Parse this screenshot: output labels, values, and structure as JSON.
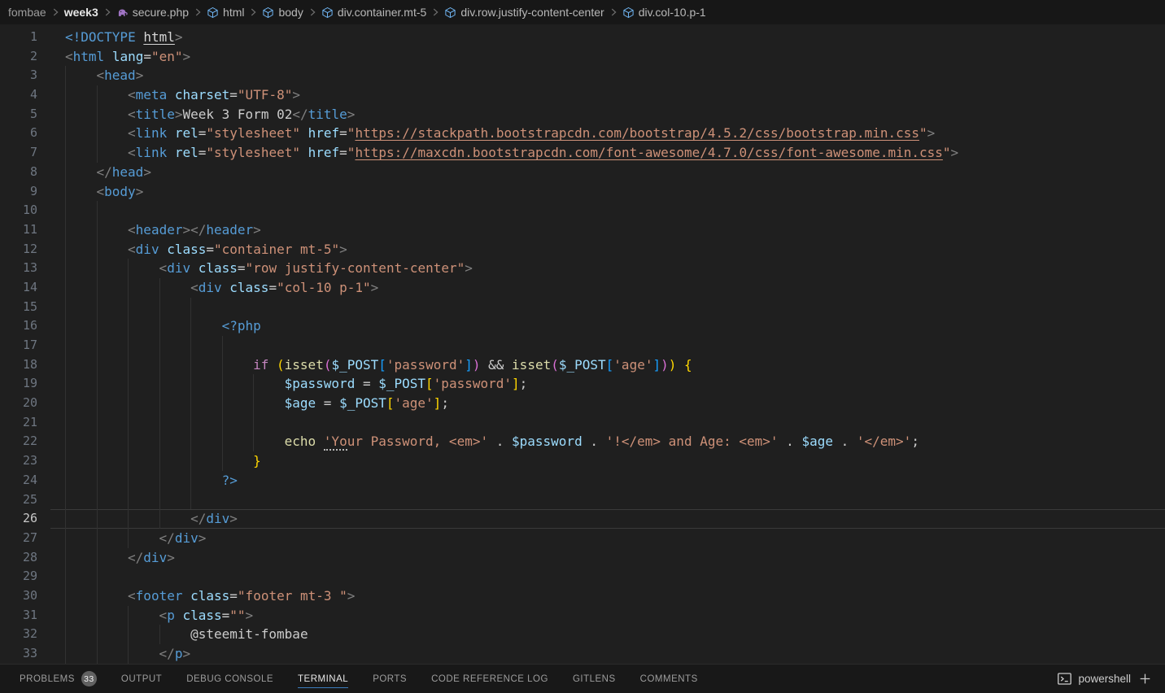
{
  "colors": {
    "bg": "#1f1f1f",
    "topbar_bg": "#171717",
    "panel_bg": "#181818",
    "border": "#2b2b2b",
    "accent": "#0078d4",
    "linenum": "#6e7681",
    "linenum_active": "#c8c8c8",
    "guide": "#313131",
    "cur_border": "#3a3a3a",
    "tag": "#569cd6",
    "punct": "#808080",
    "attr": "#9cdcfe",
    "string": "#ce9178",
    "keyword": "#c586c0",
    "func": "#dcdcaa",
    "plain": "#cccccc",
    "b1": "#ffd700",
    "b2": "#da70d6",
    "b3": "#179fff",
    "badge_bg": "#616161",
    "badge_fg": "#f2f2f2",
    "tab_fg": "#9d9d9d",
    "tab_active_fg": "#e7e7e7",
    "bc_fg": "#b8b8b8",
    "bc_dim": "#9d9d9d",
    "bc_bright": "#e7e7e7",
    "cube": "#75beff",
    "php": "#a074c4"
  },
  "breadcrumb": {
    "items": [
      {
        "label": "fombae",
        "icon": null,
        "style": "dim"
      },
      {
        "label": "week3",
        "icon": null,
        "style": "bright"
      },
      {
        "label": "secure.php",
        "icon": "php",
        "style": ""
      },
      {
        "label": "html",
        "icon": "cube",
        "style": ""
      },
      {
        "label": "body",
        "icon": "cube",
        "style": ""
      },
      {
        "label": "div.container.mt-5",
        "icon": "cube",
        "style": ""
      },
      {
        "label": "div.row.justify-content-center",
        "icon": "cube",
        "style": ""
      },
      {
        "label": "div.col-10.p-1",
        "icon": "cube",
        "style": ""
      }
    ]
  },
  "editor": {
    "current_line": 26,
    "lines": [
      {
        "n": 1,
        "ind": 0,
        "g": 0,
        "tokens": [
          [
            "t",
            "<!DOCTYPE"
          ],
          [
            "w",
            " "
          ],
          [
            "wu",
            "html"
          ],
          [
            "p",
            ">"
          ]
        ]
      },
      {
        "n": 2,
        "ind": 0,
        "g": 0,
        "tokens": [
          [
            "p",
            "<"
          ],
          [
            "t",
            "html"
          ],
          [
            "w",
            " "
          ],
          [
            "a",
            "lang"
          ],
          [
            "w",
            "="
          ],
          [
            "s",
            "\"en\""
          ],
          [
            "p",
            ">"
          ]
        ]
      },
      {
        "n": 3,
        "ind": 4,
        "g": 1,
        "tokens": [
          [
            "p",
            "<"
          ],
          [
            "t",
            "head"
          ],
          [
            "p",
            ">"
          ]
        ]
      },
      {
        "n": 4,
        "ind": 8,
        "g": 2,
        "tokens": [
          [
            "p",
            "<"
          ],
          [
            "t",
            "meta"
          ],
          [
            "w",
            " "
          ],
          [
            "a",
            "charset"
          ],
          [
            "w",
            "="
          ],
          [
            "s",
            "\"UTF-8\""
          ],
          [
            "p",
            ">"
          ]
        ]
      },
      {
        "n": 5,
        "ind": 8,
        "g": 2,
        "tokens": [
          [
            "p",
            "<"
          ],
          [
            "t",
            "title"
          ],
          [
            "p",
            ">"
          ],
          [
            "w",
            "Week 3 Form 02"
          ],
          [
            "p",
            "</"
          ],
          [
            "t",
            "title"
          ],
          [
            "p",
            ">"
          ]
        ]
      },
      {
        "n": 6,
        "ind": 8,
        "g": 2,
        "tokens": [
          [
            "p",
            "<"
          ],
          [
            "t",
            "link"
          ],
          [
            "w",
            " "
          ],
          [
            "a",
            "rel"
          ],
          [
            "w",
            "="
          ],
          [
            "s",
            "\"stylesheet\""
          ],
          [
            "w",
            " "
          ],
          [
            "a",
            "href"
          ],
          [
            "w",
            "="
          ],
          [
            "s",
            "\""
          ],
          [
            "su",
            "https://stackpath.bootstrapcdn.com/bootstrap/4.5.2/css/bootstrap.min.css"
          ],
          [
            "s",
            "\""
          ],
          [
            "p",
            ">"
          ]
        ]
      },
      {
        "n": 7,
        "ind": 8,
        "g": 2,
        "tokens": [
          [
            "p",
            "<"
          ],
          [
            "t",
            "link"
          ],
          [
            "w",
            " "
          ],
          [
            "a",
            "rel"
          ],
          [
            "w",
            "="
          ],
          [
            "s",
            "\"stylesheet\""
          ],
          [
            "w",
            " "
          ],
          [
            "a",
            "href"
          ],
          [
            "w",
            "="
          ],
          [
            "s",
            "\""
          ],
          [
            "su",
            "https://maxcdn.bootstrapcdn.com/font-awesome/4.7.0/css/font-awesome.min.css"
          ],
          [
            "s",
            "\""
          ],
          [
            "p",
            ">"
          ]
        ]
      },
      {
        "n": 8,
        "ind": 4,
        "g": 1,
        "tokens": [
          [
            "p",
            "</"
          ],
          [
            "t",
            "head"
          ],
          [
            "p",
            ">"
          ]
        ]
      },
      {
        "n": 9,
        "ind": 4,
        "g": 1,
        "tokens": [
          [
            "p",
            "<"
          ],
          [
            "t",
            "body"
          ],
          [
            "p",
            ">"
          ]
        ]
      },
      {
        "n": 10,
        "ind": 0,
        "g": 2,
        "tokens": []
      },
      {
        "n": 11,
        "ind": 8,
        "g": 2,
        "tokens": [
          [
            "p",
            "<"
          ],
          [
            "t",
            "header"
          ],
          [
            "p",
            "></"
          ],
          [
            "t",
            "header"
          ],
          [
            "p",
            ">"
          ]
        ]
      },
      {
        "n": 12,
        "ind": 8,
        "g": 2,
        "tokens": [
          [
            "p",
            "<"
          ],
          [
            "t",
            "div"
          ],
          [
            "w",
            " "
          ],
          [
            "a",
            "class"
          ],
          [
            "w",
            "="
          ],
          [
            "s",
            "\"container mt-5\""
          ],
          [
            "p",
            ">"
          ]
        ]
      },
      {
        "n": 13,
        "ind": 12,
        "g": 3,
        "tokens": [
          [
            "p",
            "<"
          ],
          [
            "t",
            "div"
          ],
          [
            "w",
            " "
          ],
          [
            "a",
            "class"
          ],
          [
            "w",
            "="
          ],
          [
            "s",
            "\"row justify-content-center\""
          ],
          [
            "p",
            ">"
          ]
        ]
      },
      {
        "n": 14,
        "ind": 16,
        "g": 4,
        "tokens": [
          [
            "p",
            "<"
          ],
          [
            "t",
            "div"
          ],
          [
            "w",
            " "
          ],
          [
            "a",
            "class"
          ],
          [
            "w",
            "="
          ],
          [
            "s",
            "\"col-10 p-1\""
          ],
          [
            "p",
            ">"
          ]
        ]
      },
      {
        "n": 15,
        "ind": 0,
        "g": 5,
        "tokens": []
      },
      {
        "n": 16,
        "ind": 20,
        "g": 5,
        "tokens": [
          [
            "t",
            "<?php"
          ]
        ]
      },
      {
        "n": 17,
        "ind": 0,
        "g": 6,
        "tokens": []
      },
      {
        "n": 18,
        "ind": 24,
        "g": 6,
        "tokens": [
          [
            "k",
            "if"
          ],
          [
            "w",
            " "
          ],
          [
            "b1",
            "("
          ],
          [
            "f",
            "isset"
          ],
          [
            "b2",
            "("
          ],
          [
            "a",
            "$_POST"
          ],
          [
            "b3",
            "["
          ],
          [
            "s",
            "'password'"
          ],
          [
            "b3",
            "]"
          ],
          [
            "b2",
            ")"
          ],
          [
            "w",
            " && "
          ],
          [
            "f",
            "isset"
          ],
          [
            "b2",
            "("
          ],
          [
            "a",
            "$_POST"
          ],
          [
            "b3",
            "["
          ],
          [
            "s",
            "'age'"
          ],
          [
            "b3",
            "]"
          ],
          [
            "b2",
            ")"
          ],
          [
            "b1",
            ")"
          ],
          [
            "w",
            " "
          ],
          [
            "b1",
            "{"
          ]
        ]
      },
      {
        "n": 19,
        "ind": 28,
        "g": 7,
        "tokens": [
          [
            "a",
            "$password"
          ],
          [
            "w",
            " = "
          ],
          [
            "a",
            "$_POST"
          ],
          [
            "b1",
            "["
          ],
          [
            "s",
            "'password'"
          ],
          [
            "b1",
            "]"
          ],
          [
            "w",
            ";"
          ]
        ]
      },
      {
        "n": 20,
        "ind": 28,
        "g": 7,
        "tokens": [
          [
            "a",
            "$age"
          ],
          [
            "w",
            " = "
          ],
          [
            "a",
            "$_POST"
          ],
          [
            "b1",
            "["
          ],
          [
            "s",
            "'age'"
          ],
          [
            "b1",
            "]"
          ],
          [
            "w",
            ";"
          ]
        ]
      },
      {
        "n": 21,
        "ind": 0,
        "g": 7,
        "tokens": []
      },
      {
        "n": 22,
        "ind": 28,
        "g": 7,
        "tokens": [
          [
            "f",
            "echo"
          ],
          [
            "w",
            " "
          ],
          [
            "sd",
            "'Yo"
          ],
          [
            "s",
            "ur Password, <em>'"
          ],
          [
            "w",
            " . "
          ],
          [
            "a",
            "$password"
          ],
          [
            "w",
            " . "
          ],
          [
            "s",
            "'!</em> and Age: <em>'"
          ],
          [
            "w",
            " . "
          ],
          [
            "a",
            "$age"
          ],
          [
            "w",
            " . "
          ],
          [
            "s",
            "'</em>'"
          ],
          [
            "w",
            ";"
          ]
        ]
      },
      {
        "n": 23,
        "ind": 24,
        "g": 6,
        "tokens": [
          [
            "b1",
            "}"
          ]
        ]
      },
      {
        "n": 24,
        "ind": 20,
        "g": 5,
        "tokens": [
          [
            "t",
            "?>"
          ]
        ]
      },
      {
        "n": 25,
        "ind": 0,
        "g": 5,
        "tokens": []
      },
      {
        "n": 26,
        "ind": 16,
        "g": 4,
        "tokens": [
          [
            "p",
            "</"
          ],
          [
            "t",
            "div"
          ],
          [
            "p",
            ">"
          ]
        ]
      },
      {
        "n": 27,
        "ind": 12,
        "g": 3,
        "tokens": [
          [
            "p",
            "</"
          ],
          [
            "t",
            "div"
          ],
          [
            "p",
            ">"
          ]
        ]
      },
      {
        "n": 28,
        "ind": 8,
        "g": 2,
        "tokens": [
          [
            "p",
            "</"
          ],
          [
            "t",
            "div"
          ],
          [
            "p",
            ">"
          ]
        ]
      },
      {
        "n": 29,
        "ind": 0,
        "g": 2,
        "tokens": []
      },
      {
        "n": 30,
        "ind": 8,
        "g": 2,
        "tokens": [
          [
            "p",
            "<"
          ],
          [
            "t",
            "footer"
          ],
          [
            "w",
            " "
          ],
          [
            "a",
            "class"
          ],
          [
            "w",
            "="
          ],
          [
            "s",
            "\"footer mt-3 \""
          ],
          [
            "p",
            ">"
          ]
        ]
      },
      {
        "n": 31,
        "ind": 12,
        "g": 3,
        "tokens": [
          [
            "p",
            "<"
          ],
          [
            "t",
            "p"
          ],
          [
            "w",
            " "
          ],
          [
            "a",
            "class"
          ],
          [
            "w",
            "="
          ],
          [
            "s",
            "\"\""
          ],
          [
            "p",
            ">"
          ]
        ]
      },
      {
        "n": 32,
        "ind": 16,
        "g": 4,
        "tokens": [
          [
            "w",
            "@steemit-fombae"
          ]
        ]
      },
      {
        "n": 33,
        "ind": 12,
        "g": 3,
        "tokens": [
          [
            "p",
            "</"
          ],
          [
            "t",
            "p"
          ],
          [
            "p",
            ">"
          ]
        ]
      }
    ]
  },
  "panel": {
    "tabs": [
      {
        "label": "PROBLEMS",
        "badge": "33",
        "active": false
      },
      {
        "label": "OUTPUT",
        "badge": null,
        "active": false
      },
      {
        "label": "DEBUG CONSOLE",
        "badge": null,
        "active": false
      },
      {
        "label": "TERMINAL",
        "badge": null,
        "active": true
      },
      {
        "label": "PORTS",
        "badge": null,
        "active": false
      },
      {
        "label": "CODE REFERENCE LOG",
        "badge": null,
        "active": false
      },
      {
        "label": "GITLENS",
        "badge": null,
        "active": false
      },
      {
        "label": "COMMENTS",
        "badge": null,
        "active": false
      }
    ],
    "terminal_label": "powershell"
  }
}
